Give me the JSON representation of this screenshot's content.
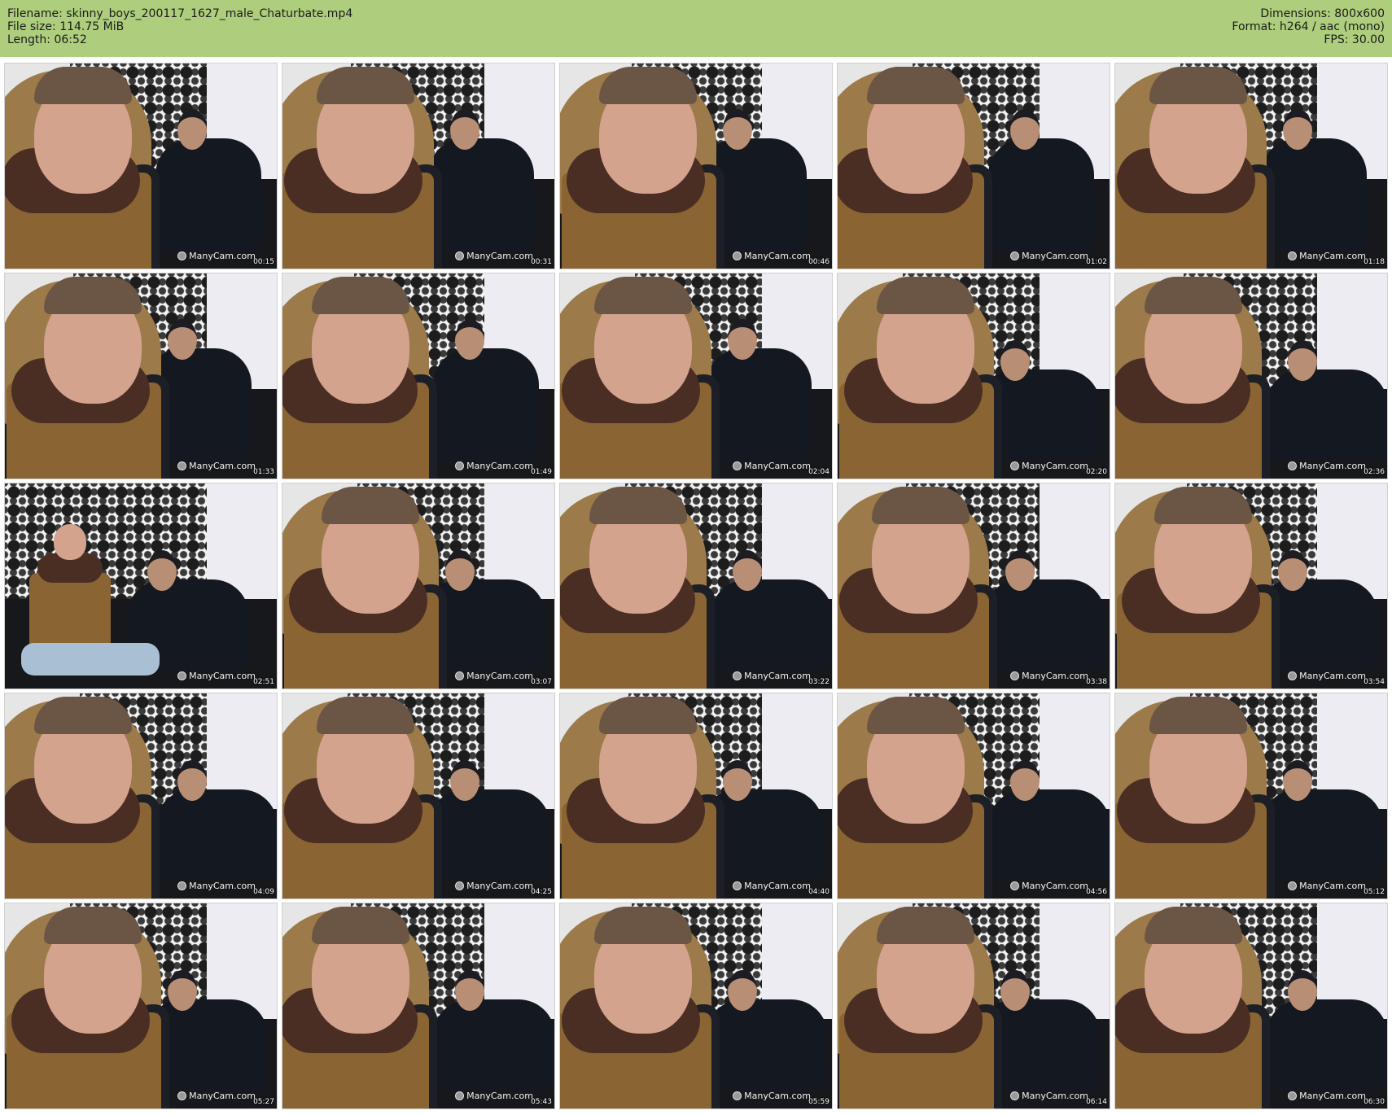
{
  "header": {
    "filename_line": "Filename: skinny_boys_200117_1627_male_Chaturbate.mp4",
    "filesize_line": "File size: 114.75 MiB",
    "length_line": "Length: 06:52",
    "dimensions_line": "Dimensions: 800x600",
    "format_line": "Format: h264 / aac (mono)",
    "fps_line": "FPS: 30.00"
  },
  "colors": {
    "header_background": "#aece7d"
  },
  "watermark": "ManyCam.com",
  "thumbnails": [
    {
      "timestamp": "00:15"
    },
    {
      "timestamp": "00:31"
    },
    {
      "timestamp": "00:46"
    },
    {
      "timestamp": "01:02"
    },
    {
      "timestamp": "01:18"
    },
    {
      "timestamp": "01:33"
    },
    {
      "timestamp": "01:49"
    },
    {
      "timestamp": "02:04"
    },
    {
      "timestamp": "02:20"
    },
    {
      "timestamp": "02:36"
    },
    {
      "timestamp": "02:51"
    },
    {
      "timestamp": "03:07"
    },
    {
      "timestamp": "03:22"
    },
    {
      "timestamp": "03:38"
    },
    {
      "timestamp": "03:54"
    },
    {
      "timestamp": "04:09"
    },
    {
      "timestamp": "04:25"
    },
    {
      "timestamp": "04:40"
    },
    {
      "timestamp": "04:56"
    },
    {
      "timestamp": "05:12"
    },
    {
      "timestamp": "05:27"
    },
    {
      "timestamp": "05:43"
    },
    {
      "timestamp": "05:59"
    },
    {
      "timestamp": "06:14"
    },
    {
      "timestamp": "06:30"
    }
  ]
}
